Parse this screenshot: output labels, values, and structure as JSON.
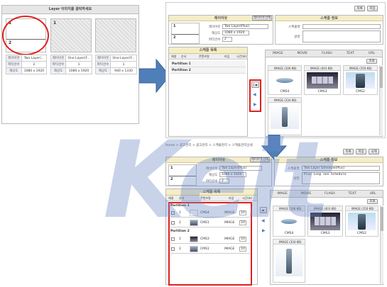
{
  "left_panel": {
    "title": "Layer 이미지를 클릭하세요",
    "layouts": [
      {
        "number": "1",
        "sub": "2",
        "rows": [
          [
            "레이아웃",
            "Two Layer(..."
          ],
          [
            "파티션수",
            "2"
          ],
          [
            "해상도",
            "1080 x 1920"
          ]
        ]
      },
      {
        "number": "1",
        "sub": "",
        "rows": [
          [
            "레이아웃",
            "One Layer(F..."
          ],
          [
            "파티션수",
            "1"
          ],
          [
            "해상도",
            "1080 x 1920"
          ]
        ]
      },
      {
        "number": "",
        "sub": "",
        "rows": [
          [
            "레이아웃",
            "One Layer(F..."
          ],
          [
            "파티션수",
            "1"
          ],
          [
            "해상도",
            "940 x 1330"
          ]
        ]
      }
    ]
  },
  "top_right": {
    "buttons": [
      "목록",
      "저장"
    ],
    "layout_header": "레이아웃",
    "layout_button": "레이아웃선택",
    "schedule_header": "스케줄 정보",
    "layout_fields": [
      [
        "레이아웃",
        "Two Layer(Plus)"
      ],
      [
        "해상도",
        "1080 x 1920"
      ],
      [
        "파티션수",
        "2"
      ]
    ],
    "schedule_fields": [
      "스케줄명",
      "설명"
    ],
    "thumb_numbers": [
      "1",
      "2"
    ],
    "list_header": "스케줄 목록",
    "list_columns": [
      "재생",
      "순서",
      "콘텐츠명",
      "타입",
      "시간(초)"
    ],
    "partitions": [
      "Partition 1",
      "Partition 2"
    ],
    "tabs": [
      "IMAGE",
      "MOVIE",
      "FLASH",
      "TEXT",
      "URL"
    ],
    "search_button": "조회",
    "images": [
      {
        "cap": "IMAGE (106 KB)",
        "name": "CMS4",
        "style": "oval"
      },
      {
        "cap": "IMAGE (403 KB)",
        "name": "CMS3",
        "style": "dark"
      },
      {
        "cap": "IMAGE (150 KB)",
        "name": "CMS2",
        "style": "blue"
      },
      {
        "cap": "IMAGE (334 KB)",
        "name": "CMS1",
        "style": "kiosk"
      }
    ],
    "arrows": [
      "1 ▶",
      "◀",
      "▶"
    ]
  },
  "bottom": {
    "breadcrumb": "Home > 광고관리 > 광고관리 > 스케줄관리 > 스케줄관리상세",
    "buttons": [
      "목록",
      "저장",
      "삭제"
    ],
    "layout_header": "레이아웃",
    "layout_button": "레이아웃선택",
    "schedule_header": "스케줄 정보",
    "layout_fields": [
      [
        "레이아웃",
        "Two Layer(Plus)"
      ],
      [
        "해상도",
        "1080 x 1920"
      ],
      [
        "파티션수",
        "2"
      ]
    ],
    "schedule_name_label": "스케줄명",
    "schedule_name_value": "Two Layer Schedule(Plus)",
    "desc_label": "설명",
    "desc_value": "Plus Loop one Schedule",
    "list_header": "스케줄 목록",
    "list_columns": [
      "재생",
      "순서",
      "콘텐츠명",
      "타입",
      "시간(초)"
    ],
    "partitions": [
      {
        "title": "Partition 1",
        "rows": [
          [
            "1",
            "CMS4",
            "IMAGE",
            "10"
          ],
          [
            "2",
            "CMS1",
            "IMAGE",
            "10"
          ]
        ]
      },
      {
        "title": "Partition 2",
        "rows": [
          [
            "1",
            "CMS3",
            "IMAGE",
            "10"
          ],
          [
            "2",
            "CMS1",
            "IMAGE",
            "10"
          ]
        ]
      }
    ],
    "tabs": [
      "IMAGE",
      "MOVIE",
      "FLASH",
      "TEXT",
      "URL"
    ],
    "search_button": "조회",
    "images": [
      {
        "cap": "IMAGE (106 KB)",
        "name": "CMS4",
        "style": "oval"
      },
      {
        "cap": "IMAGE (403 KB)",
        "name": "CMS3",
        "style": "dark"
      },
      {
        "cap": "IMAGE (150 KB)",
        "name": "CMS2",
        "style": "blue"
      },
      {
        "cap": "IMAGE (334 KB)",
        "name": "CMS1",
        "style": "kiosk"
      }
    ],
    "arrows": [
      "▶",
      "◀",
      "▶"
    ]
  },
  "watermark": "Keit",
  "colors": {
    "highlight": "#e02020",
    "arrow": "#4f7fb8",
    "header_yellow": "#f5edc8"
  }
}
